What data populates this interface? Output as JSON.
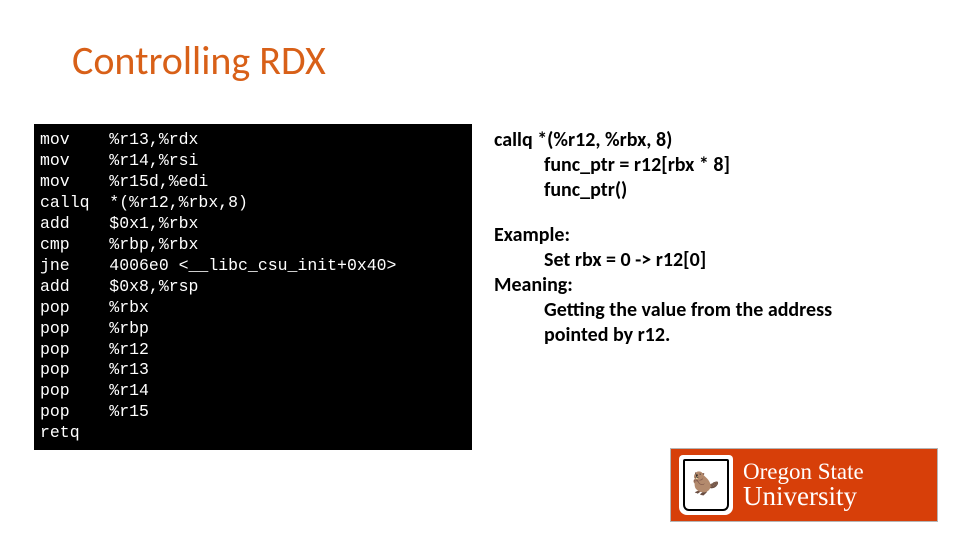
{
  "title": "Controlling RDX",
  "asm": {
    "lines": [
      [
        "mov",
        "%r13,%rdx"
      ],
      [
        "mov",
        "%r14,%rsi"
      ],
      [
        "mov",
        "%r15d,%edi"
      ],
      [
        "callq",
        "*(%r12,%rbx,8)"
      ],
      [
        "add",
        "$0x1,%rbx"
      ],
      [
        "cmp",
        "%rbp,%rbx"
      ],
      [
        "jne",
        "4006e0 <__libc_csu_init+0x40>"
      ],
      [
        "add",
        "$0x8,%rsp"
      ],
      [
        "pop",
        "%rbx"
      ],
      [
        "pop",
        "%rbp"
      ],
      [
        "pop",
        "%r12"
      ],
      [
        "pop",
        "%r13"
      ],
      [
        "pop",
        "%r14"
      ],
      [
        "pop",
        "%r15"
      ],
      [
        "retq",
        ""
      ]
    ]
  },
  "explain": {
    "line1": "callq *(%r12, %rbx, 8)",
    "line2": "func_ptr = r12[rbx * 8]",
    "line3": "func_ptr()",
    "example_label": "Example:",
    "example_body": "Set rbx = 0 -> r12[0]",
    "meaning_label": "Meaning:",
    "meaning_body1": "Getting the value from the address",
    "meaning_body2": "pointed by r12."
  },
  "logo": {
    "line1": "Oregon State",
    "line2": "University"
  }
}
